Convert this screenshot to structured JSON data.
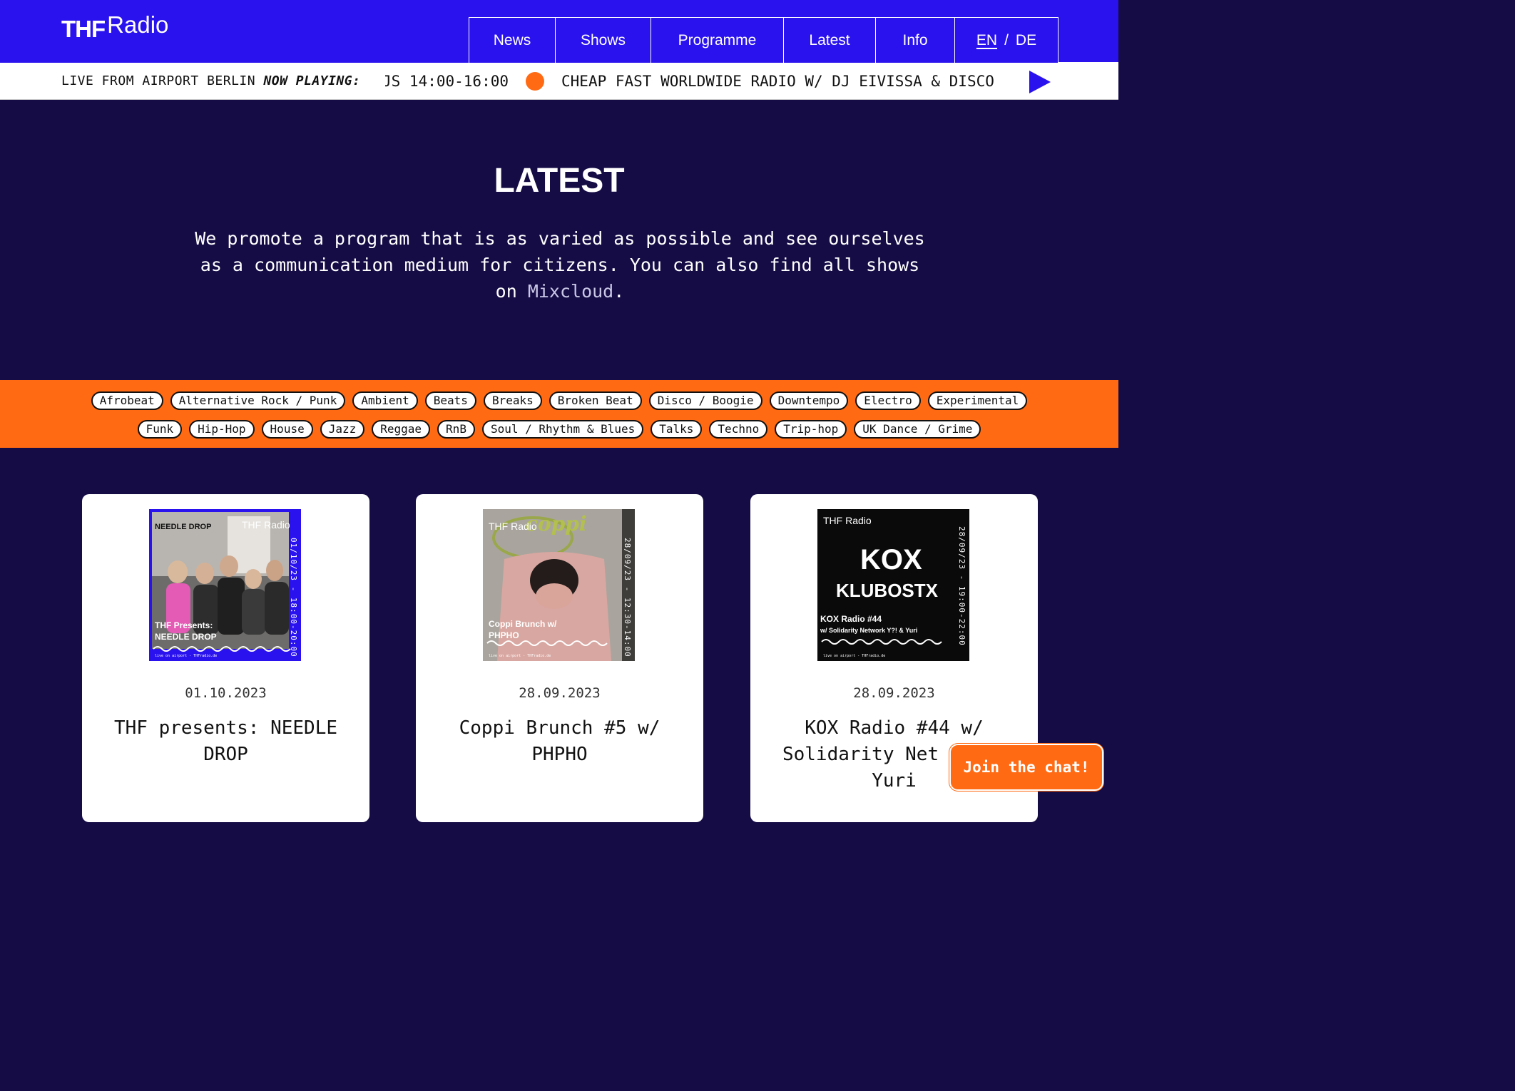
{
  "brand": {
    "thf": "THF",
    "radio": "Radio"
  },
  "nav": {
    "items": [
      "News",
      "Shows",
      "Programme",
      "Latest",
      "Info"
    ],
    "lang_en": "EN",
    "lang_sep": "/",
    "lang_de": "DE"
  },
  "ticker": {
    "live_prefix": "LIVE FROM AIRPORT BERLIN",
    "now_playing": "NOW PLAYING:",
    "show_part": "JS 14:00-16:00",
    "next_show": "CHEAP FAST WORLDWIDE RADIO W/ DJ EIVISSA & DISCO"
  },
  "hero": {
    "title": "LATEST",
    "text": "We promote a program that is as varied as possible and see ourselves as a communication medium for citizens. You can also find all shows on ",
    "link": "Mixcloud",
    "text_end": "."
  },
  "genres": {
    "row1": [
      "Afrobeat",
      "Alternative Rock / Punk",
      "Ambient",
      "Beats",
      "Breaks",
      "Broken Beat",
      "Disco / Boogie",
      "Downtempo",
      "Electro",
      "Experimental"
    ],
    "row2": [
      "Funk",
      "Hip-Hop",
      "House",
      "Jazz",
      "Reggae",
      "RnB",
      "Soul / Rhythm & Blues",
      "Talks",
      "Techno",
      "Trip-hop",
      "UK Dance / Grime"
    ]
  },
  "cards": [
    {
      "date": "01.10.2023",
      "title": "THF presents: NEEDLE DROP",
      "thumb_top": "NEEDLE DROP",
      "thumb_label": "THF Presents: NEEDLE DROP",
      "thumb_date": "01/10/23 - 18:00-20:00",
      "thumb_footer": "live on airport - THFradio.de"
    },
    {
      "date": "28.09.2023",
      "title": "Coppi Brunch #5 w/ PHPHO",
      "thumb_top": "coppi",
      "thumb_label": "Coppi Brunch w/ PHPHO",
      "thumb_date": "28/09/23 - 12:30-14:00",
      "thumb_footer": "live on airport - THFradio.de"
    },
    {
      "date": "28.09.2023",
      "title": "KOX Radio #44 w/ Solidarity Net Y?! & Yuri",
      "thumb_top": "KOX",
      "thumb_sub": "KLUBOSTX",
      "thumb_label": "KOX Radio #44",
      "thumb_label2": "w/ Solidarity Network Y?! & Yuri",
      "thumb_date": "28/09/23 - 19:00-22:00",
      "thumb_footer": "live on airport - THFradio.de"
    }
  ],
  "chat_button": "Join the chat!",
  "colors": {
    "header": "#2a12ee",
    "background": "#150c45",
    "accent": "#ff6a13"
  }
}
